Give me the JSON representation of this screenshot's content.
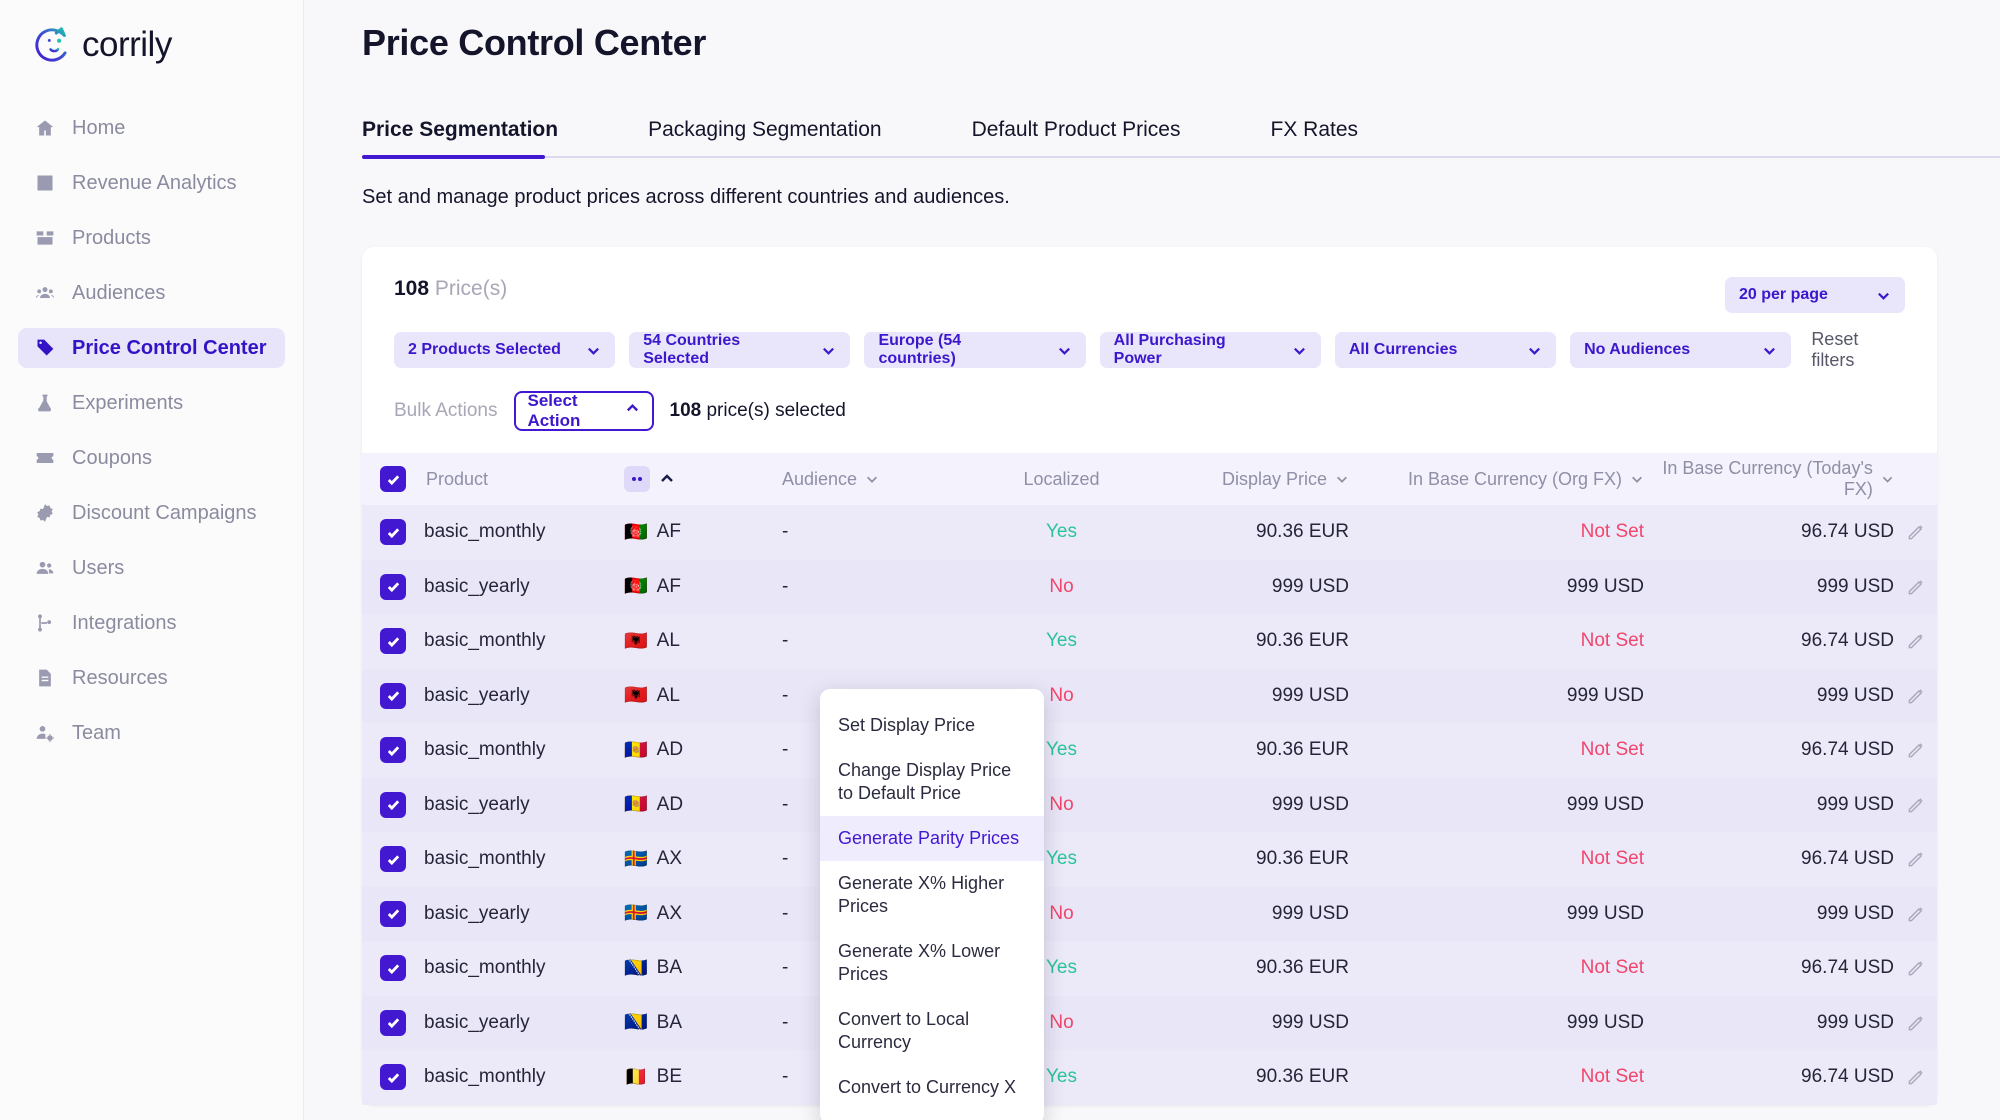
{
  "brand": {
    "name": "corrily",
    "accent": "#4318d1",
    "logo_icon": "corrily-cat-logo"
  },
  "sidebar": {
    "items": [
      {
        "label": "Home",
        "icon": "home-icon",
        "active": false
      },
      {
        "label": "Revenue Analytics",
        "icon": "chart-icon",
        "active": false
      },
      {
        "label": "Products",
        "icon": "box-icon",
        "active": false
      },
      {
        "label": "Audiences",
        "icon": "audiences-icon",
        "active": false
      },
      {
        "label": "Price Control Center",
        "icon": "tag-icon",
        "active": true
      },
      {
        "label": "Experiments",
        "icon": "flask-icon",
        "active": false
      },
      {
        "label": "Coupons",
        "icon": "coupon-icon",
        "active": false
      },
      {
        "label": "Discount Campaigns",
        "icon": "percent-badge-icon",
        "active": false
      },
      {
        "label": "Users",
        "icon": "users-icon",
        "active": false
      },
      {
        "label": "Integrations",
        "icon": "integrations-icon",
        "active": false
      },
      {
        "label": "Resources",
        "icon": "document-icon",
        "active": false
      },
      {
        "label": "Team",
        "icon": "team-icon",
        "active": false
      }
    ]
  },
  "header": {
    "title": "Price Control Center"
  },
  "tabs": [
    {
      "label": "Price Segmentation",
      "active": true
    },
    {
      "label": "Packaging Segmentation",
      "active": false
    },
    {
      "label": "Default Product Prices",
      "active": false
    },
    {
      "label": "FX Rates",
      "active": false
    }
  ],
  "subtitle": "Set and manage product prices across different countries and audiences.",
  "card": {
    "count_number": "108",
    "count_label": "Price(s)",
    "per_page": "20 per page",
    "filters": [
      {
        "label": "2 Products Selected",
        "name": "products-filter"
      },
      {
        "label": "54 Countries Selected",
        "name": "countries-filter"
      },
      {
        "label": "Europe (54 countries)",
        "name": "region-filter"
      },
      {
        "label": "All Purchasing Power",
        "name": "purchasing-power-filter"
      },
      {
        "label": "All Currencies",
        "name": "currencies-filter"
      },
      {
        "label": "No Audiences",
        "name": "audiences-filter"
      }
    ],
    "reset_filters": "Reset filters",
    "bulk": {
      "label": "Bulk Actions",
      "select_action": "Select Action",
      "selected_count": "108",
      "selected_suffix": " price(s) selected"
    },
    "menu_items": [
      {
        "label": "Set Display Price",
        "highlighted": false
      },
      {
        "label": "Change Display Price to Default Price",
        "highlighted": false
      },
      {
        "label": "Generate Parity Prices",
        "highlighted": true
      },
      {
        "label": "Generate X% Higher Prices",
        "highlighted": false
      },
      {
        "label": "Generate X% Lower Prices",
        "highlighted": false
      },
      {
        "label": "Convert to Local Currency",
        "highlighted": false
      },
      {
        "label": "Convert to Currency X",
        "highlighted": false
      }
    ]
  },
  "table": {
    "columns": [
      {
        "label": "Product",
        "sortable": false
      },
      {
        "label": "Audience",
        "sortable": true
      },
      {
        "label": "Localized",
        "sortable": false
      },
      {
        "label": "Display Price",
        "sortable": true
      },
      {
        "label": "In Base Currency (Org FX)",
        "sortable": true
      },
      {
        "label": "In Base Currency (Today's FX)",
        "sortable": true
      }
    ],
    "rows": [
      {
        "checked": true,
        "product": "basic_monthly",
        "flag": "🇦🇫",
        "country": "AF",
        "audience": "-",
        "localized": "Yes",
        "display_price": "90.36 EUR",
        "org_fx": "Not Set",
        "today_fx": "96.74 USD"
      },
      {
        "checked": true,
        "product": "basic_yearly",
        "flag": "🇦🇫",
        "country": "AF",
        "audience": "-",
        "localized": "No",
        "display_price": "999 USD",
        "org_fx": "999 USD",
        "today_fx": "999 USD"
      },
      {
        "checked": true,
        "product": "basic_monthly",
        "flag": "🇦🇱",
        "country": "AL",
        "audience": "-",
        "localized": "Yes",
        "display_price": "90.36 EUR",
        "org_fx": "Not Set",
        "today_fx": "96.74 USD"
      },
      {
        "checked": true,
        "product": "basic_yearly",
        "flag": "🇦🇱",
        "country": "AL",
        "audience": "-",
        "localized": "No",
        "display_price": "999 USD",
        "org_fx": "999 USD",
        "today_fx": "999 USD"
      },
      {
        "checked": true,
        "product": "basic_monthly",
        "flag": "🇦🇩",
        "country": "AD",
        "audience": "-",
        "localized": "Yes",
        "display_price": "90.36 EUR",
        "org_fx": "Not Set",
        "today_fx": "96.74 USD"
      },
      {
        "checked": true,
        "product": "basic_yearly",
        "flag": "🇦🇩",
        "country": "AD",
        "audience": "-",
        "localized": "No",
        "display_price": "999 USD",
        "org_fx": "999 USD",
        "today_fx": "999 USD"
      },
      {
        "checked": true,
        "product": "basic_monthly",
        "flag": "🇦🇽",
        "country": "AX",
        "audience": "-",
        "localized": "Yes",
        "display_price": "90.36 EUR",
        "org_fx": "Not Set",
        "today_fx": "96.74 USD"
      },
      {
        "checked": true,
        "product": "basic_yearly",
        "flag": "🇦🇽",
        "country": "AX",
        "audience": "-",
        "localized": "No",
        "display_price": "999 USD",
        "org_fx": "999 USD",
        "today_fx": "999 USD"
      },
      {
        "checked": true,
        "product": "basic_monthly",
        "flag": "🇧🇦",
        "country": "BA",
        "audience": "-",
        "localized": "Yes",
        "display_price": "90.36 EUR",
        "org_fx": "Not Set",
        "today_fx": "96.74 USD"
      },
      {
        "checked": true,
        "product": "basic_yearly",
        "flag": "🇧🇦",
        "country": "BA",
        "audience": "-",
        "localized": "No",
        "display_price": "999 USD",
        "org_fx": "999 USD",
        "today_fx": "999 USD"
      },
      {
        "checked": true,
        "product": "basic_monthly",
        "flag": "🇧🇪",
        "country": "BE",
        "audience": "-",
        "localized": "Yes",
        "display_price": "90.36 EUR",
        "org_fx": "Not Set",
        "today_fx": "96.74 USD"
      }
    ]
  }
}
